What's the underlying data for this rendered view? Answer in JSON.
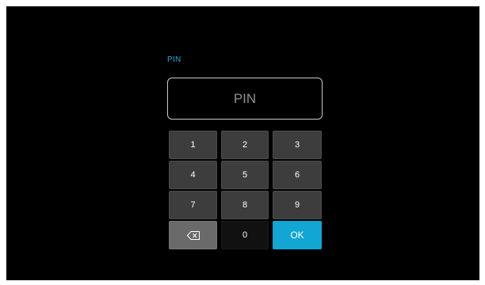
{
  "pin": {
    "label": "PIN",
    "placeholder": "PIN",
    "value": ""
  },
  "keypad": {
    "keys": [
      "1",
      "2",
      "3",
      "4",
      "5",
      "6",
      "7",
      "8",
      "9"
    ],
    "zero": "0",
    "ok": "OK",
    "backspace_icon": "backspace-icon"
  },
  "colors": {
    "accent": "#12a6d4",
    "label": "#29a9d8",
    "key_bg": "#3d3d3d",
    "backspace_bg": "#6a6a6a",
    "screen_bg": "#000000"
  }
}
